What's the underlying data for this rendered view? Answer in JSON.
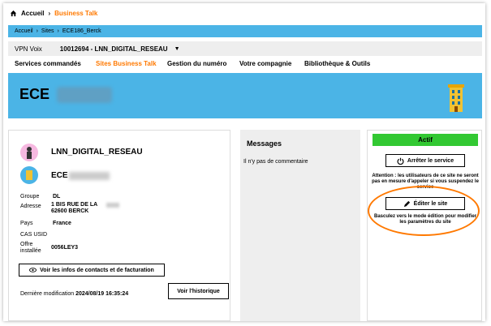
{
  "breadcrumb_top": {
    "home": "Accueil",
    "current": "Business Talk"
  },
  "breadcrumb_bar": {
    "items": [
      "Accueil",
      "Sites",
      "ECE186_Berck"
    ]
  },
  "vpn": {
    "label": "VPN Voix",
    "value": "10012694 - LNN_DIGITAL_RESEAU"
  },
  "tabs": [
    "Services commandés",
    "Sites Business Talk",
    "Gestion du numéro",
    "Votre compagnie",
    "Bibliothèque & Outils"
  ],
  "banner": {
    "title": "ECE"
  },
  "site_info": {
    "name": "LNN_DIGITAL_RESEAU",
    "site_prefix": "ECE",
    "groupe_label": "Groupe",
    "groupe_value": "DL",
    "adresse_label": "Adresse",
    "adresse_line1": "1 BIS RUE DE LA",
    "adresse_line2": "62600 BERCK",
    "pays_label": "Pays",
    "pays_value": "France",
    "cas_label": "CAS USID",
    "offre_label_1": "Offre",
    "offre_label_2": "installée",
    "offre_value": "0056LEY3",
    "contacts_button": "Voir les infos de contacts et de facturation",
    "lastmod_label": "Dernière modification",
    "lastmod_value": "2024/08/19 16:35:24",
    "history_button": "Voir l'historique"
  },
  "messages": {
    "title": "Messages",
    "text": "Il n'y pas de commentaire"
  },
  "service": {
    "status": "Actif",
    "stop_button": "Arrêter le service",
    "warning": "Attention : les utilisateurs de ce site ne seront pas en mesure d'appeler si vous suspendez le service",
    "edit_button": "Éditer le site",
    "edit_hint": "Basculez vers le mode édition pour modifier les paramètres du site"
  },
  "colors": {
    "accent": "#ff7900",
    "blue": "#4bb4e6",
    "active_green": "#32c832"
  }
}
